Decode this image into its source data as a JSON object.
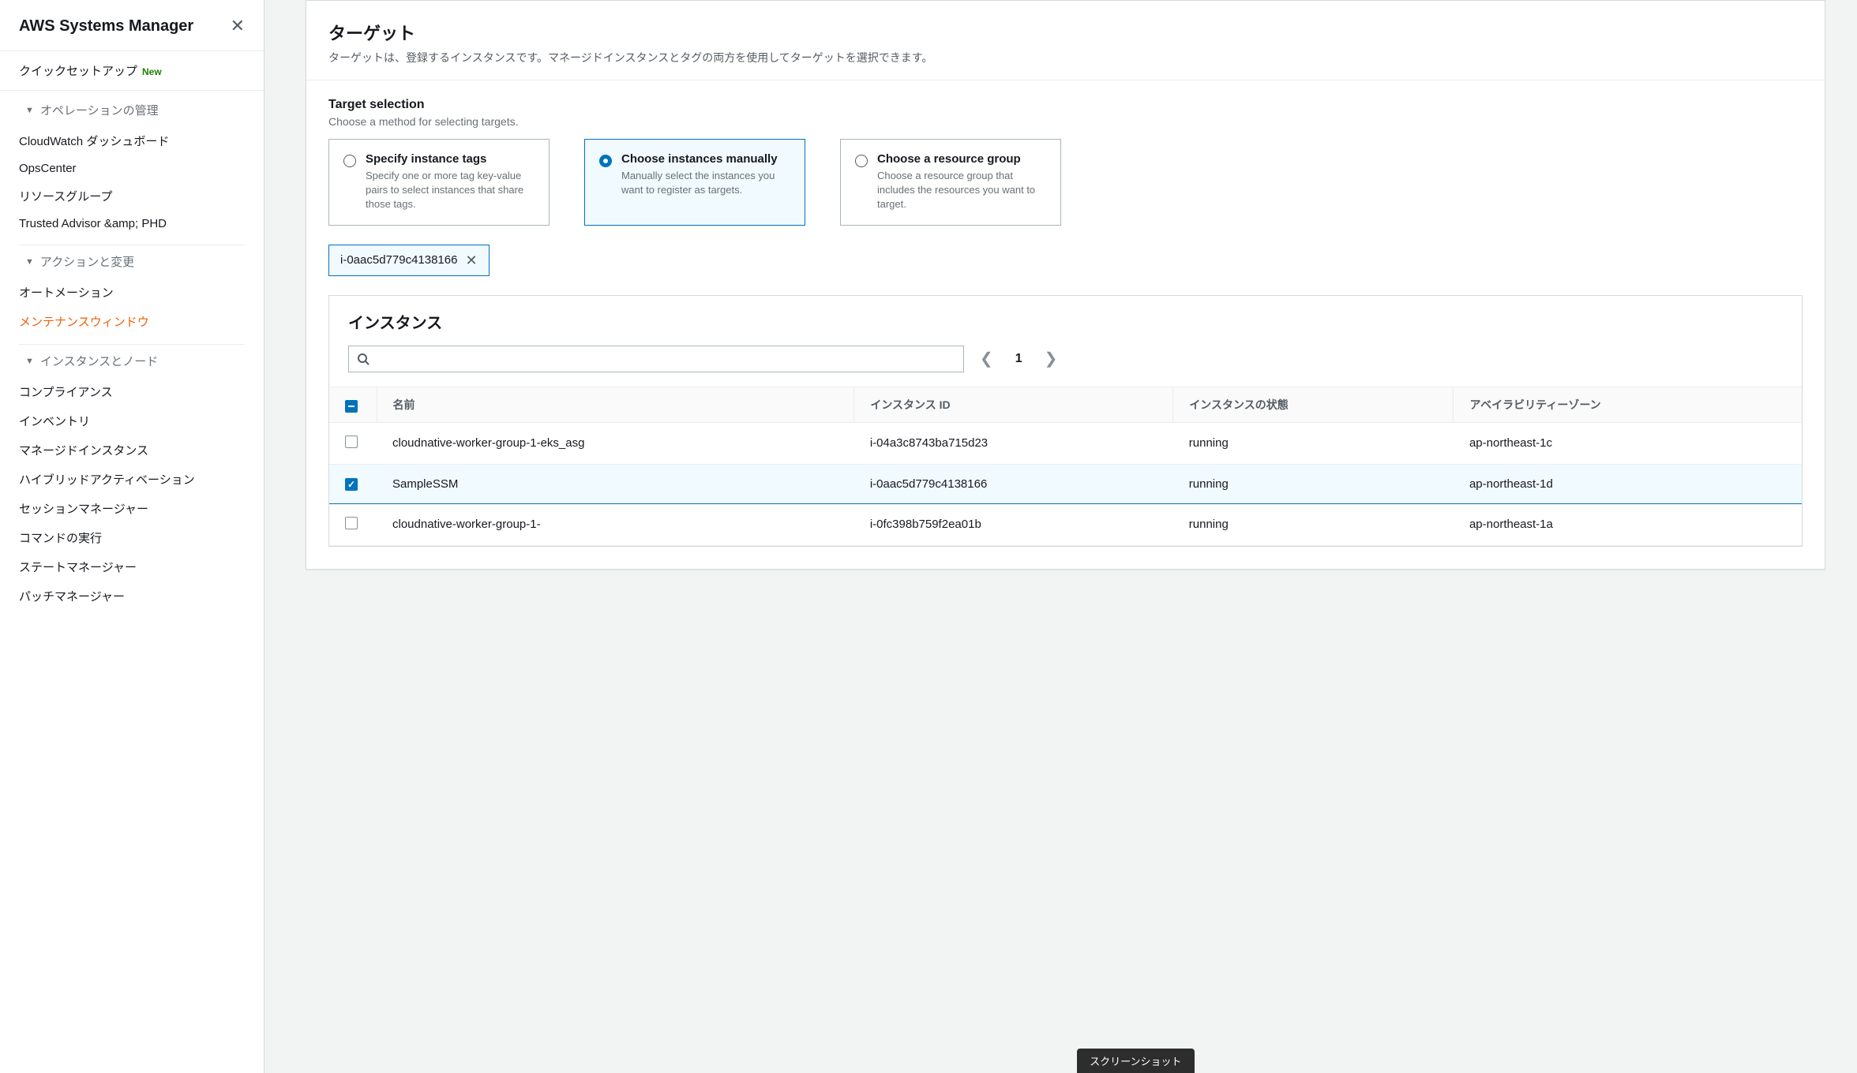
{
  "sidebar": {
    "title": "AWS Systems Manager",
    "quick_setup": {
      "label": "クイックセットアップ",
      "badge": "New"
    },
    "sections": [
      {
        "header": "オペレーションの管理",
        "items": [
          {
            "label": "CloudWatch ダッシュボード"
          },
          {
            "label": "OpsCenter"
          },
          {
            "label": "リソースグループ"
          },
          {
            "label": "Trusted Advisor &amp; PHD"
          }
        ]
      },
      {
        "header": "アクションと変更",
        "items": [
          {
            "label": "オートメーション"
          },
          {
            "label": "メンテナンスウィンドウ",
            "active": true
          }
        ]
      },
      {
        "header": "インスタンスとノード",
        "items": [
          {
            "label": "コンプライアンス"
          },
          {
            "label": "インベントリ"
          },
          {
            "label": "マネージドインスタンス"
          },
          {
            "label": "ハイブリッドアクティベーション"
          },
          {
            "label": "セッションマネージャー"
          },
          {
            "label": "コマンドの実行"
          },
          {
            "label": "ステートマネージャー"
          },
          {
            "label": "パッチマネージャー"
          }
        ]
      }
    ]
  },
  "main": {
    "target_panel": {
      "title": "ターゲット",
      "subtitle": "ターゲットは、登録するインスタンスです。マネージドインスタンスとタグの両方を使用してターゲットを選択できます。"
    },
    "selection": {
      "title": "Target selection",
      "subtitle": "Choose a method for selecting targets.",
      "options": [
        {
          "title": "Specify instance tags",
          "desc": "Specify one or more tag key-value pairs to select instances that share those tags."
        },
        {
          "title": "Choose instances manually",
          "desc": "Manually select the instances you want to register as targets."
        },
        {
          "title": "Choose a resource group",
          "desc": "Choose a resource group that includes the resources you want to target."
        }
      ]
    },
    "token": {
      "label": "i-0aac5d779c4138166"
    },
    "instances": {
      "title": "インスタンス",
      "search_placeholder": "",
      "page": "1",
      "columns": {
        "name": "名前",
        "id": "インスタンス ID",
        "state": "インスタンスの状態",
        "az": "アベイラビリティーゾーン"
      },
      "rows": [
        {
          "name": "cloudnative-worker-group-1-eks_asg",
          "id": "i-04a3c8743ba715d23",
          "state": "running",
          "az": "ap-northeast-1c",
          "checked": false
        },
        {
          "name": "SampleSSM",
          "id": "i-0aac5d779c4138166",
          "state": "running",
          "az": "ap-northeast-1d",
          "checked": true
        },
        {
          "name": "cloudnative-worker-group-1-",
          "id": "i-0fc398b759f2ea01b",
          "state": "running",
          "az": "ap-northeast-1a",
          "checked": false
        }
      ]
    }
  },
  "hint": "スクリーンショット"
}
